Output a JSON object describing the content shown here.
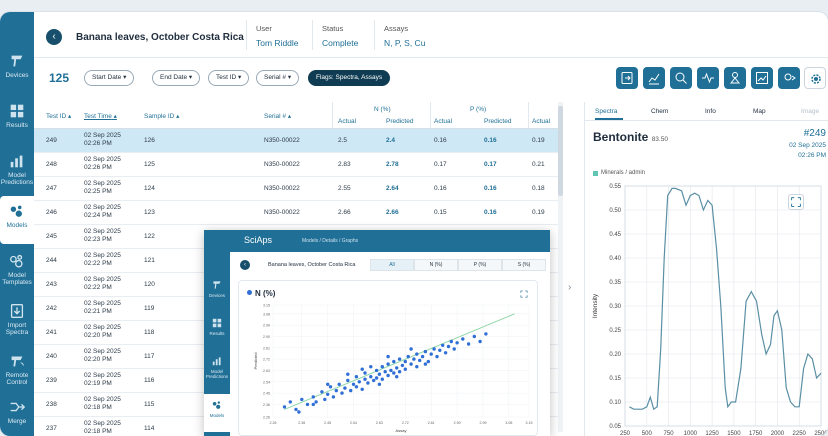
{
  "sidebar": {
    "items": [
      {
        "label": "Devices",
        "icon": "device-icon"
      },
      {
        "label": "Results",
        "icon": "results-icon"
      },
      {
        "label": "Model Predictions",
        "icon": "chart-icon"
      },
      {
        "label": "Models",
        "icon": "models-icon",
        "active": true
      },
      {
        "label": "Model Templates",
        "icon": "templates-icon"
      },
      {
        "label": "Import Spectra",
        "icon": "import-icon"
      },
      {
        "label": "Remote Control",
        "icon": "remote-icon"
      },
      {
        "label": "Merge",
        "icon": "merge-icon"
      }
    ]
  },
  "header": {
    "title": "Banana leaves, October Costa Rica",
    "user_label": "User",
    "user_value": "Tom Riddle",
    "status_label": "Status",
    "status_value": "Complete",
    "assays_label": "Assays",
    "assays_value": "N, P, S, Cu"
  },
  "toolbar": {
    "count": "125",
    "start_date": "Start Date",
    "end_date": "End Date",
    "test_id": "Test ID",
    "serial": "Serial #",
    "flags": "Flags: Spectra, Assays"
  },
  "table": {
    "headers": {
      "test_id": "Test ID",
      "test_time": "Test Time",
      "sample_id": "Sample ID",
      "serial": "Serial #",
      "n_group": "N (%)",
      "p_group": "P (%)",
      "actual": "Actual",
      "predicted": "Predicted"
    },
    "rows": [
      {
        "test_id": "249",
        "date": "02 Sep 2025",
        "time": "02:26 PM",
        "sample": "126",
        "serial": "N350-00022",
        "n_act": "2.5",
        "n_pred": "2.4",
        "p_act": "0.16",
        "p_pred": "0.16",
        "a3": "0.19"
      },
      {
        "test_id": "248",
        "date": "02 Sep 2025",
        "time": "02:26 PM",
        "sample": "125",
        "serial": "N350-00022",
        "n_act": "2.83",
        "n_pred": "2.78",
        "p_act": "0.17",
        "p_pred": "0.17",
        "a3": "0.21"
      },
      {
        "test_id": "247",
        "date": "02 Sep 2025",
        "time": "02:25 PM",
        "sample": "124",
        "serial": "N350-00022",
        "n_act": "2.55",
        "n_pred": "2.64",
        "p_act": "0.16",
        "p_pred": "0.16",
        "a3": "0.18"
      },
      {
        "test_id": "246",
        "date": "02 Sep 2025",
        "time": "02:24 PM",
        "sample": "123",
        "serial": "N350-00022",
        "n_act": "2.66",
        "n_pred": "2.66",
        "p_act": "0.15",
        "p_pred": "0.16",
        "a3": "0.19"
      },
      {
        "test_id": "245",
        "date": "02 Sep 2025",
        "time": "02:23 PM",
        "sample": "122",
        "serial": "",
        "n_act": "",
        "n_pred": "",
        "p_act": "",
        "p_pred": "",
        "a3": ""
      },
      {
        "test_id": "244",
        "date": "02 Sep 2025",
        "time": "02:22 PM",
        "sample": "121",
        "serial": "",
        "n_act": "",
        "n_pred": "",
        "p_act": "",
        "p_pred": "",
        "a3": ""
      },
      {
        "test_id": "243",
        "date": "02 Sep 2025",
        "time": "02:22 PM",
        "sample": "120",
        "serial": "",
        "n_act": "",
        "n_pred": "",
        "p_act": "",
        "p_pred": "",
        "a3": ""
      },
      {
        "test_id": "242",
        "date": "02 Sep 2025",
        "time": "02:21 PM",
        "sample": "119",
        "serial": "",
        "n_act": "",
        "n_pred": "",
        "p_act": "",
        "p_pred": "",
        "a3": ""
      },
      {
        "test_id": "241",
        "date": "02 Sep 2025",
        "time": "02:20 PM",
        "sample": "118",
        "serial": "",
        "n_act": "",
        "n_pred": "",
        "p_act": "",
        "p_pred": "",
        "a3": ""
      },
      {
        "test_id": "240",
        "date": "02 Sep 2025",
        "time": "02:20 PM",
        "sample": "117",
        "serial": "",
        "n_act": "",
        "n_pred": "",
        "p_act": "",
        "p_pred": "",
        "a3": ""
      },
      {
        "test_id": "239",
        "date": "02 Sep 2025",
        "time": "02:19 PM",
        "sample": "116",
        "serial": "",
        "n_act": "",
        "n_pred": "",
        "p_act": "",
        "p_pred": "",
        "a3": ""
      },
      {
        "test_id": "238",
        "date": "02 Sep 2025",
        "time": "02:18 PM",
        "sample": "115",
        "serial": "",
        "n_act": "",
        "n_pred": "",
        "p_act": "",
        "p_pred": "",
        "a3": ""
      },
      {
        "test_id": "237",
        "date": "02 Sep 2025",
        "time": "02:18 PM",
        "sample": "114",
        "serial": "",
        "n_act": "",
        "n_pred": "",
        "p_act": "",
        "p_pred": "",
        "a3": ""
      }
    ]
  },
  "right_panel": {
    "tabs": [
      "Spectra",
      "Chem",
      "Info",
      "Map",
      "Image"
    ],
    "mineral": "Bentonite",
    "score": "83.50",
    "test_id": "#249",
    "date": "02 Sep 2025",
    "time": "02:26 PM",
    "legend": "Minerals / admin",
    "ylabel": "Intensity"
  },
  "overlay": {
    "logo": "SciAps",
    "crumb": "Models  /  Details  /  Graphs",
    "title": "Banana leaves, October Costa Rica",
    "tabs": [
      "All",
      "N (%)",
      "P (%)",
      "S (%)"
    ],
    "chart_title": "N (%)",
    "sidebar": [
      "Devices",
      "Results",
      "Model Predictions",
      "Models"
    ]
  },
  "chart_data": [
    {
      "type": "line",
      "title": "",
      "ylabel": "Intensity",
      "xlabel": "",
      "xlim": [
        250,
        2500
      ],
      "ylim": [
        0.05,
        0.55
      ],
      "x_ticks": [
        250,
        500,
        750,
        1000,
        1250,
        1500,
        1750,
        2000,
        2250,
        2500
      ],
      "y_ticks": [
        0.05,
        0.1,
        0.15,
        0.2,
        0.25,
        0.3,
        0.35,
        0.4,
        0.45,
        0.5,
        0.55
      ],
      "grid": true,
      "color": "#5a8fa5",
      "series": [
        {
          "x": [
            300,
            350,
            450,
            500,
            540,
            580,
            620,
            660,
            700,
            740,
            790,
            830,
            900,
            950,
            1000,
            1050,
            1100,
            1150,
            1200,
            1250,
            1300,
            1350,
            1400,
            1430,
            1470,
            1520,
            1580,
            1640,
            1700,
            1760,
            1820,
            1870,
            1920,
            1960,
            2000,
            2050,
            2100,
            2150,
            2200,
            2250,
            2300,
            2350,
            2400,
            2450,
            2500
          ],
          "y": [
            0.09,
            0.085,
            0.085,
            0.09,
            0.11,
            0.085,
            0.09,
            0.21,
            0.4,
            0.53,
            0.545,
            0.545,
            0.54,
            0.51,
            0.53,
            0.535,
            0.53,
            0.5,
            0.52,
            0.51,
            0.42,
            0.3,
            0.13,
            0.09,
            0.1,
            0.1,
            0.17,
            0.31,
            0.33,
            0.31,
            0.24,
            0.2,
            0.22,
            0.28,
            0.29,
            0.25,
            0.13,
            0.1,
            0.09,
            0.09,
            0.17,
            0.2,
            0.19,
            0.15,
            0.16
          ]
        }
      ]
    },
    {
      "type": "scatter",
      "title": "N (%)",
      "xlabel": "Assay",
      "ylabel": "Predicted",
      "xlim": [
        2.26,
        3.15
      ],
      "ylim": [
        2.26,
        3.15
      ],
      "x_ticks": [
        "2.26",
        "2.36",
        "2.45",
        "2.54",
        "2.63",
        "2.72",
        "2.81",
        "2.90",
        "2.99",
        "3.08",
        "3.15"
      ],
      "y_ticks": [
        "2.26",
        "2.36",
        "2.45",
        "2.54",
        "2.63",
        "2.72",
        "2.81",
        "2.90",
        "2.99",
        "3.08",
        "3.15"
      ],
      "fit_line": {
        "x": [
          2.3,
          3.1
        ],
        "y": [
          2.32,
          3.08
        ],
        "color": "#8fd6a6"
      },
      "point_color": "#2f6fd6",
      "points": [
        [
          2.3,
          2.34
        ],
        [
          2.32,
          2.38
        ],
        [
          2.34,
          2.32
        ],
        [
          2.36,
          2.4
        ],
        [
          2.38,
          2.36
        ],
        [
          2.4,
          2.42
        ],
        [
          2.41,
          2.38
        ],
        [
          2.43,
          2.46
        ],
        [
          2.44,
          2.4
        ],
        [
          2.45,
          2.44
        ],
        [
          2.46,
          2.5
        ],
        [
          2.47,
          2.42
        ],
        [
          2.48,
          2.47
        ],
        [
          2.49,
          2.52
        ],
        [
          2.5,
          2.45
        ],
        [
          2.51,
          2.49
        ],
        [
          2.52,
          2.55
        ],
        [
          2.53,
          2.47
        ],
        [
          2.54,
          2.52
        ],
        [
          2.55,
          2.58
        ],
        [
          2.55,
          2.5
        ],
        [
          2.56,
          2.54
        ],
        [
          2.57,
          2.48
        ],
        [
          2.58,
          2.56
        ],
        [
          2.58,
          2.61
        ],
        [
          2.59,
          2.53
        ],
        [
          2.6,
          2.58
        ],
        [
          2.61,
          2.55
        ],
        [
          2.62,
          2.63
        ],
        [
          2.62,
          2.57
        ],
        [
          2.63,
          2.6
        ],
        [
          2.64,
          2.66
        ],
        [
          2.64,
          2.56
        ],
        [
          2.65,
          2.62
        ],
        [
          2.66,
          2.59
        ],
        [
          2.66,
          2.68
        ],
        [
          2.67,
          2.63
        ],
        [
          2.68,
          2.61
        ],
        [
          2.68,
          2.7
        ],
        [
          2.69,
          2.65
        ],
        [
          2.7,
          2.62
        ],
        [
          2.7,
          2.72
        ],
        [
          2.71,
          2.67
        ],
        [
          2.72,
          2.7
        ],
        [
          2.72,
          2.64
        ],
        [
          2.73,
          2.74
        ],
        [
          2.74,
          2.68
        ],
        [
          2.75,
          2.72
        ],
        [
          2.76,
          2.66
        ],
        [
          2.76,
          2.76
        ],
        [
          2.77,
          2.71
        ],
        [
          2.78,
          2.74
        ],
        [
          2.79,
          2.78
        ],
        [
          2.8,
          2.7
        ],
        [
          2.81,
          2.76
        ],
        [
          2.82,
          2.8
        ],
        [
          2.83,
          2.74
        ],
        [
          2.84,
          2.79
        ],
        [
          2.85,
          2.83
        ],
        [
          2.86,
          2.77
        ],
        [
          2.87,
          2.82
        ],
        [
          2.88,
          2.86
        ],
        [
          2.89,
          2.8
        ],
        [
          2.9,
          2.85
        ],
        [
          2.92,
          2.88
        ],
        [
          2.94,
          2.84
        ],
        [
          2.96,
          2.9
        ],
        [
          2.98,
          2.86
        ],
        [
          3.0,
          2.92
        ],
        [
          2.52,
          2.6
        ],
        [
          2.57,
          2.64
        ],
        [
          2.63,
          2.52
        ],
        [
          2.69,
          2.58
        ],
        [
          2.74,
          2.8
        ],
        [
          2.79,
          2.68
        ],
        [
          2.45,
          2.52
        ],
        [
          2.4,
          2.36
        ],
        [
          2.35,
          2.3
        ],
        [
          2.6,
          2.66
        ],
        [
          2.66,
          2.74
        ]
      ]
    }
  ]
}
